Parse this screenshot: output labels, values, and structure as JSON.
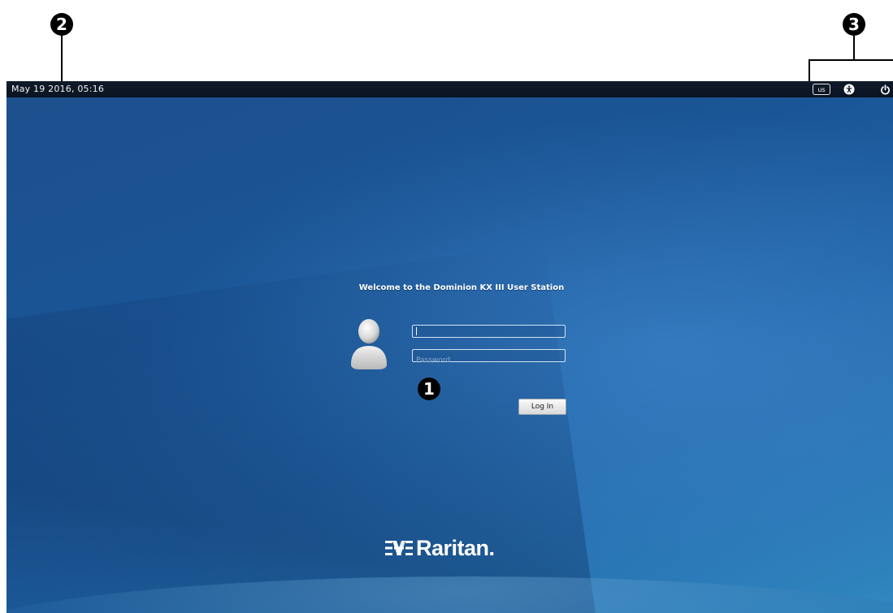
{
  "callouts": {
    "login": "1",
    "clock": "2",
    "tray": "3"
  },
  "top_panel": {
    "datetime": "May 19 2016, 05:16",
    "keyboard_layout": "us",
    "accessibility_icon": "accessibility-icon",
    "power_icon": "power-icon"
  },
  "login": {
    "welcome_text": "Welcome to the Dominion KX III User Station",
    "username_value": "",
    "password_placeholder": "Password",
    "login_button_label": "Log In"
  },
  "branding": {
    "logo_text": "Raritan."
  },
  "colors": {
    "panel": "#0b1422",
    "background_primary": "#1a5596",
    "background_light": "#3188c0",
    "text": "#ffffff"
  }
}
